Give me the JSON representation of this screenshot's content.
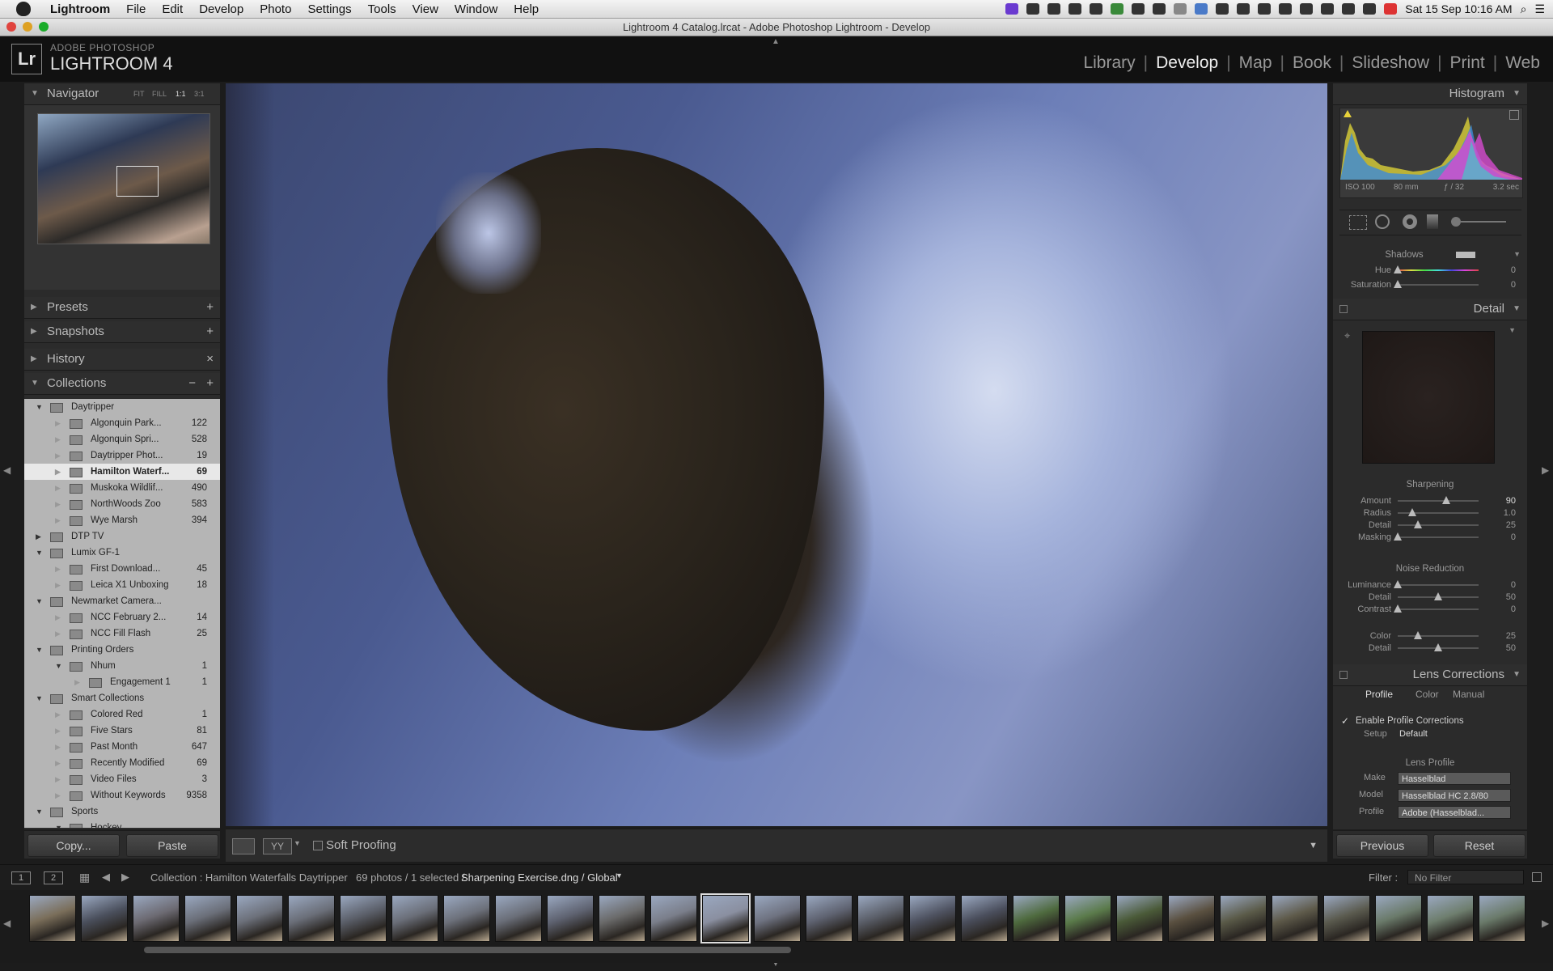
{
  "menubar": {
    "app": "Lightroom",
    "items": [
      "File",
      "Edit",
      "Develop",
      "Photo",
      "Settings",
      "Tools",
      "View",
      "Window",
      "Help"
    ],
    "clock": "Sat 15 Sep  10:16 AM"
  },
  "window": {
    "title": "Lightroom 4 Catalog.lrcat - Adobe Photoshop Lightroom - Develop"
  },
  "brand": {
    "logo": "Lr",
    "line1": "ADOBE PHOTOSHOP",
    "line2": "LIGHTROOM 4"
  },
  "modules": [
    {
      "label": "Library",
      "active": false
    },
    {
      "label": "Develop",
      "active": true
    },
    {
      "label": "Map",
      "active": false
    },
    {
      "label": "Book",
      "active": false
    },
    {
      "label": "Slideshow",
      "active": false
    },
    {
      "label": "Print",
      "active": false
    },
    {
      "label": "Web",
      "active": false
    }
  ],
  "left": {
    "navigator": {
      "title": "Navigator",
      "zoom": [
        "FIT",
        "FILL",
        "1:1",
        "3:1"
      ]
    },
    "presets": "Presets",
    "snapshots": "Snapshots",
    "history": "History",
    "collections": "Collections",
    "collection_items": [
      {
        "name": "Daytripper",
        "count": "",
        "depth": 0,
        "open": true,
        "sel": false
      },
      {
        "name": "Algonquin Park...",
        "count": "122",
        "depth": 1,
        "open": false,
        "sel": false
      },
      {
        "name": "Algonquin Spri...",
        "count": "528",
        "depth": 1,
        "open": false,
        "sel": false
      },
      {
        "name": "Daytripper Phot...",
        "count": "19",
        "depth": 1,
        "open": false,
        "sel": false
      },
      {
        "name": "Hamilton Waterf...",
        "count": "69",
        "depth": 1,
        "open": false,
        "sel": true
      },
      {
        "name": "Muskoka Wildlif...",
        "count": "490",
        "depth": 1,
        "open": false,
        "sel": false
      },
      {
        "name": "NorthWoods Zoo",
        "count": "583",
        "depth": 1,
        "open": false,
        "sel": false
      },
      {
        "name": "Wye Marsh",
        "count": "394",
        "depth": 1,
        "open": false,
        "sel": false
      },
      {
        "name": "DTP TV",
        "count": "",
        "depth": 0,
        "open": false,
        "sel": false
      },
      {
        "name": "Lumix GF-1",
        "count": "",
        "depth": 0,
        "open": true,
        "sel": false
      },
      {
        "name": "First Download...",
        "count": "45",
        "depth": 1,
        "open": false,
        "sel": false
      },
      {
        "name": "Leica X1 Unboxing",
        "count": "18",
        "depth": 1,
        "open": false,
        "sel": false
      },
      {
        "name": "Newmarket Camera...",
        "count": "",
        "depth": 0,
        "open": true,
        "sel": false
      },
      {
        "name": "NCC February 2...",
        "count": "14",
        "depth": 1,
        "open": false,
        "sel": false
      },
      {
        "name": "NCC Fill Flash",
        "count": "25",
        "depth": 1,
        "open": false,
        "sel": false
      },
      {
        "name": "Printing Orders",
        "count": "",
        "depth": 0,
        "open": true,
        "sel": false
      },
      {
        "name": "Nhum",
        "count": "1",
        "depth": 1,
        "open": true,
        "sel": false
      },
      {
        "name": "Engagement 1",
        "count": "1",
        "depth": 2,
        "open": false,
        "sel": false
      },
      {
        "name": "Smart Collections",
        "count": "",
        "depth": 0,
        "open": true,
        "sel": false
      },
      {
        "name": "Colored Red",
        "count": "1",
        "depth": 1,
        "open": false,
        "sel": false
      },
      {
        "name": "Five Stars",
        "count": "81",
        "depth": 1,
        "open": false,
        "sel": false
      },
      {
        "name": "Past Month",
        "count": "647",
        "depth": 1,
        "open": false,
        "sel": false
      },
      {
        "name": "Recently Modified",
        "count": "69",
        "depth": 1,
        "open": false,
        "sel": false
      },
      {
        "name": "Video Files",
        "count": "3",
        "depth": 1,
        "open": false,
        "sel": false
      },
      {
        "name": "Without Keywords",
        "count": "9358",
        "depth": 1,
        "open": false,
        "sel": false
      },
      {
        "name": "Sports",
        "count": "",
        "depth": 0,
        "open": true,
        "sel": false
      },
      {
        "name": "Hockey",
        "count": "",
        "depth": 1,
        "open": true,
        "sel": false
      }
    ],
    "copy_label": "Copy...",
    "paste_label": "Paste"
  },
  "toolbar": {
    "soft_proofing": "Soft Proofing",
    "view_mode": "YY"
  },
  "right": {
    "histogram": {
      "title": "Histogram",
      "iso": "ISO 100",
      "focal": "80 mm",
      "aperture": "ƒ / 32",
      "shutter": "3.2 sec"
    },
    "split": {
      "shadows_label": "Shadows",
      "hue_label": "Hue",
      "hue_value": "0",
      "sat_label": "Saturation",
      "sat_value": "0"
    },
    "detail": {
      "title": "Detail"
    },
    "sharpening": {
      "title": "Sharpening",
      "sliders": [
        {
          "label": "Amount",
          "value": "90",
          "pos": 0.6
        },
        {
          "label": "Radius",
          "value": "1.0",
          "pos": 0.18
        },
        {
          "label": "Detail",
          "value": "25",
          "pos": 0.25
        },
        {
          "label": "Masking",
          "value": "0",
          "pos": 0.0
        }
      ]
    },
    "noise": {
      "title": "Noise Reduction",
      "sliders": [
        {
          "label": "Luminance",
          "value": "0",
          "pos": 0.0
        },
        {
          "label": "Detail",
          "value": "50",
          "pos": 0.5
        },
        {
          "label": "Contrast",
          "value": "0",
          "pos": 0.0
        },
        {
          "label": "Color",
          "value": "25",
          "pos": 0.25
        },
        {
          "label": "Detail",
          "value": "50",
          "pos": 0.5
        }
      ]
    },
    "lens": {
      "title": "Lens Corrections",
      "tabs": [
        "Profile",
        "Color",
        "Manual"
      ],
      "enable_label": "Enable Profile Corrections",
      "setup_label": "Setup",
      "setup_value": "Default",
      "profile_head": "Lens Profile",
      "make_label": "Make",
      "make_value": "Hasselblad",
      "model_label": "Model",
      "model_value": "Hasselblad HC 2.8/80",
      "profile_label": "Profile",
      "profile_value": "Adobe (Hasselblad..."
    },
    "previous_label": "Previous",
    "reset_label": "Reset"
  },
  "filmstrip": {
    "views": [
      "1",
      "2"
    ],
    "source": "Collection : Hamilton Waterfalls Daytripper",
    "count": "69 photos / 1 selected /",
    "file": "Sharpening Exercise.dng / Global",
    "filter_label": "Filter :",
    "filter_value": "No Filter"
  }
}
